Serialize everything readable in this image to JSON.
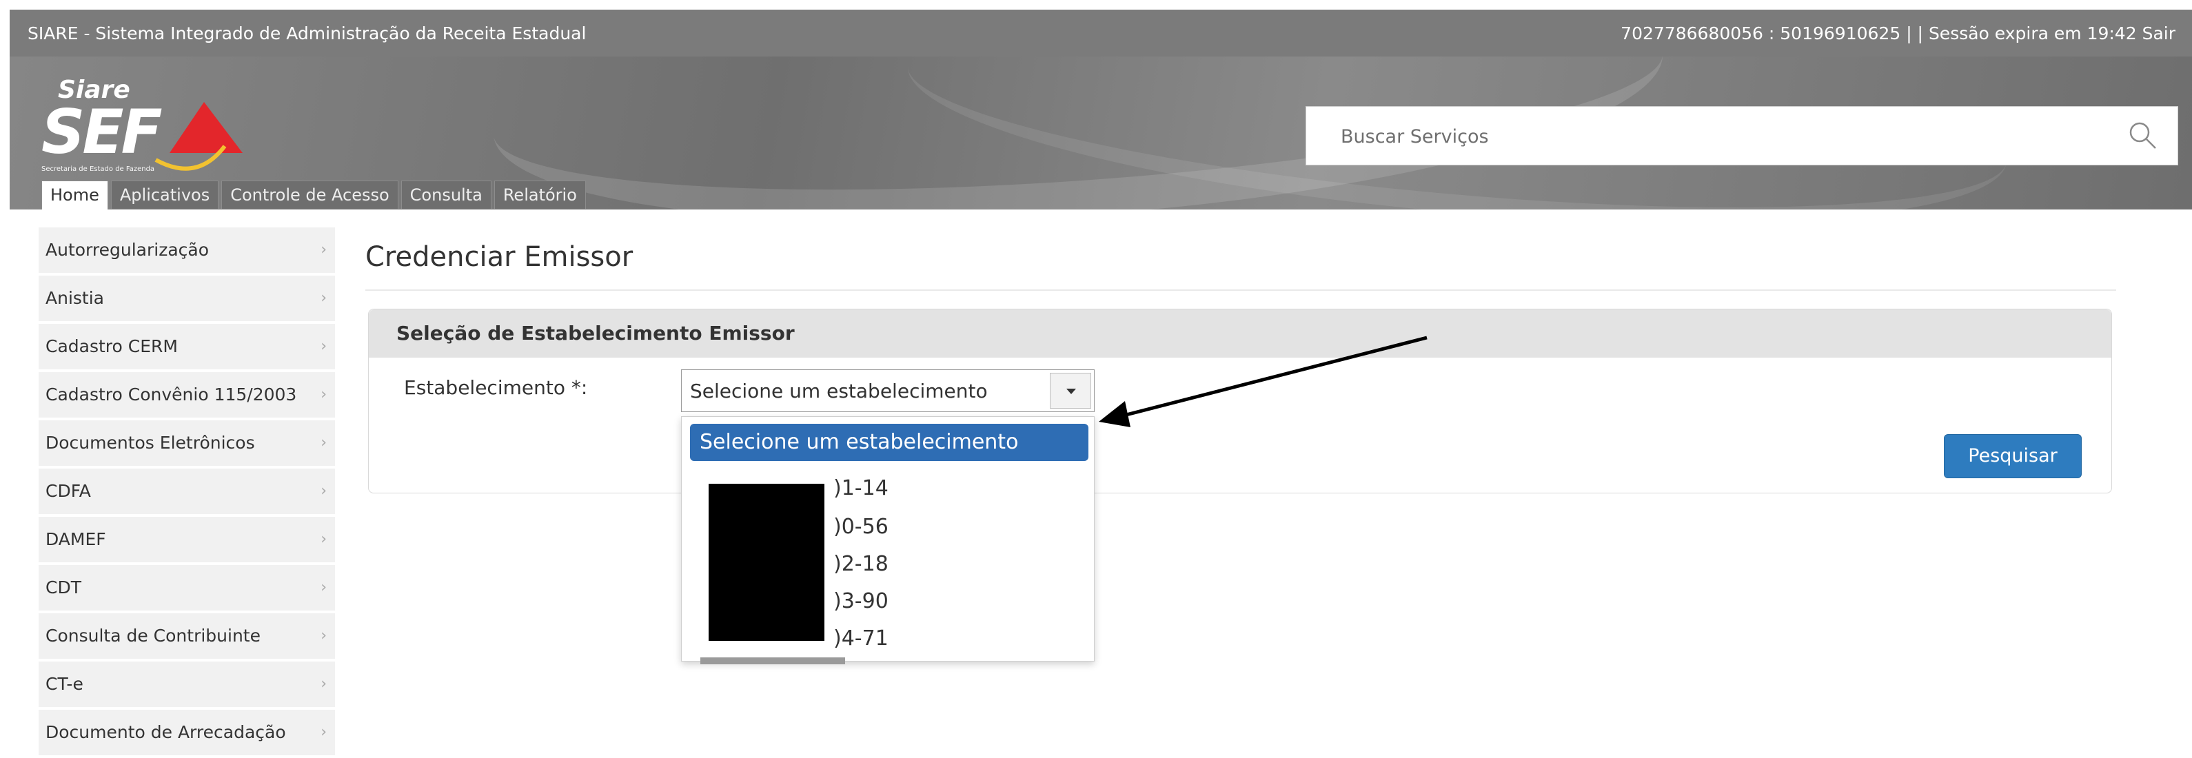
{
  "topbar": {
    "title": "SIARE - Sistema Integrado de Administração da Receita Estadual",
    "user_ids": "7027786680056 : 50196910625",
    "separator": "| |",
    "session": "Sessão expira em 19:42",
    "logout": "Sair"
  },
  "logo": {
    "top_text": "Siare",
    "main_text": "SEF",
    "sub_text": "Secretaria de Estado de Fazenda"
  },
  "search": {
    "placeholder": "Buscar Serviços",
    "icon": "search-icon"
  },
  "tabs": [
    {
      "label": "Home",
      "active": true
    },
    {
      "label": "Aplicativos"
    },
    {
      "label": "Controle de Acesso"
    },
    {
      "label": "Consulta"
    },
    {
      "label": "Relatório"
    }
  ],
  "sidebar": {
    "items": [
      {
        "label": "Autorregularização"
      },
      {
        "label": "Anistia"
      },
      {
        "label": "Cadastro CERM"
      },
      {
        "label": "Cadastro Convênio 115/2003"
      },
      {
        "label": "Documentos Eletrônicos"
      },
      {
        "label": "CDFA"
      },
      {
        "label": "DAMEF"
      },
      {
        "label": "CDT"
      },
      {
        "label": "Consulta de Contribuinte"
      },
      {
        "label": "CT-e"
      },
      {
        "label": "Documento de Arrecadação"
      }
    ],
    "chevron": "›"
  },
  "main": {
    "page_title": "Credenciar Emissor",
    "panel_title": "Seleção de Estabelecimento Emissor",
    "field_label": "Estabelecimento *:",
    "select_value": "Selecione um estabelecimento",
    "search_button": "Pesquisar"
  },
  "dropdown": {
    "selected": "Selecione um estabelecimento",
    "options": [
      ")1-14",
      ")0-56",
      ")2-18",
      ")3-90",
      ")4-71"
    ]
  },
  "colors": {
    "topbar": "#7b7b7b",
    "accent_blue": "#2e7cbf",
    "selected_option": "#2e6db4",
    "logo_red": "#e3262b"
  }
}
